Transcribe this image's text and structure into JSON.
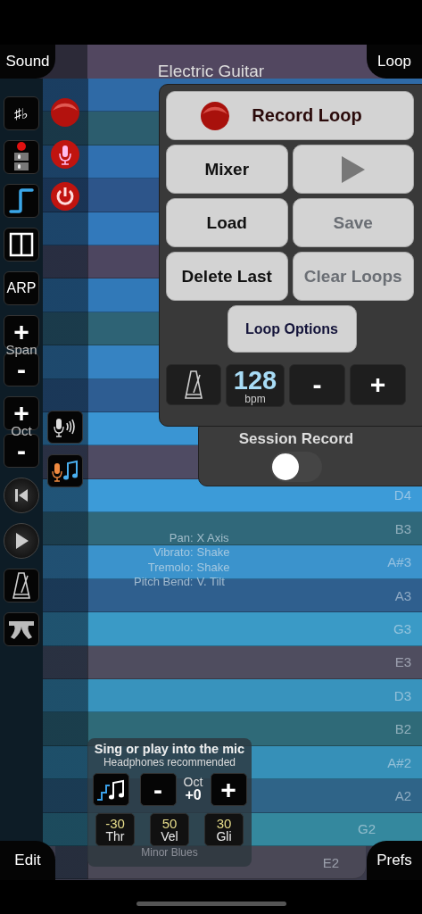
{
  "top_left_tab": {
    "label": "Sound"
  },
  "top_right_tab": {
    "label": "Loop"
  },
  "instrument_title": "Electric Guitar",
  "rows": [
    {
      "color": "#2f6aa6"
    },
    {
      "color": "#2c5d6e"
    },
    {
      "color": "#3070b0"
    },
    {
      "color": "#2d558a"
    },
    {
      "color": "#3279bb"
    },
    {
      "color": "#4d4660"
    },
    {
      "color": "#3179b8"
    },
    {
      "color": "#2e6375"
    },
    {
      "color": "#3683c2"
    },
    {
      "color": "#2e5d92"
    },
    {
      "color": "#3a95d3"
    },
    {
      "color": "#4f4b63"
    },
    {
      "color": "#3c9bd8",
      "note": "D4"
    },
    {
      "color": "#30687a",
      "note": "B3"
    },
    {
      "color": "#3b93cc",
      "note": "A#3"
    },
    {
      "color": "#2f5f8e",
      "note": "A3"
    },
    {
      "color": "#3a9ac6",
      "note": "G3"
    },
    {
      "color": "#4f4d5f",
      "note": "E3"
    },
    {
      "color": "#3893bd",
      "note": "D3"
    },
    {
      "color": "#2f6a78",
      "note": "B2"
    },
    {
      "color": "#3690b8",
      "note": "A#2"
    },
    {
      "color": "#2f6488",
      "note": "A2"
    },
    {
      "color": "#34889e",
      "note": "G2"
    },
    {
      "color": "#4a4856",
      "note": "E2"
    }
  ],
  "sidebar": [
    {
      "kind": "text",
      "label": "♯♭"
    },
    {
      "kind": "mode-stack"
    },
    {
      "kind": "step"
    },
    {
      "kind": "split"
    },
    {
      "kind": "text",
      "label": "ARP"
    },
    {
      "kind": "stepper",
      "label": "Span",
      "plus": "+",
      "minus": "-"
    },
    {
      "kind": "stepper",
      "label": "Oct",
      "plus": "+",
      "minus": "-"
    },
    {
      "kind": "rewind"
    },
    {
      "kind": "play"
    },
    {
      "kind": "metronome"
    },
    {
      "kind": "pedal"
    }
  ],
  "red_buttons": [
    {
      "kind": "record"
    },
    {
      "kind": "mic"
    },
    {
      "kind": "power"
    }
  ],
  "pitch_buttons": [
    {
      "kind": "mic-sound"
    },
    {
      "kind": "mic-note"
    }
  ],
  "loop_panel": {
    "record_button": "Record Loop",
    "buttons": [
      {
        "kind": "text",
        "label": "Mixer",
        "disabled": false
      },
      {
        "kind": "play",
        "disabled": false
      },
      {
        "kind": "text",
        "label": "Load",
        "disabled": false
      },
      {
        "kind": "text",
        "label": "Save",
        "disabled": true
      },
      {
        "kind": "text",
        "label": "Delete Last",
        "disabled": false
      },
      {
        "kind": "text",
        "label": "Clear Loops",
        "disabled": true
      }
    ],
    "options_button": "Loop Options",
    "tempo": {
      "value": "128",
      "unit": "bpm"
    },
    "tempo_minus": "-",
    "tempo_plus": "+"
  },
  "session_record": {
    "label": "Session Record",
    "on": false
  },
  "gesture_hints": [
    {
      "label": "Pan:",
      "value": "X Axis"
    },
    {
      "label": "Vibrato:",
      "value": "Shake"
    },
    {
      "label": "Tremolo:",
      "value": "Shake"
    },
    {
      "label": "Pitch Bend:",
      "value": "V. Tilt"
    }
  ],
  "mic_panel": {
    "title": "Sing or play into the mic",
    "subtitle": "Headphones recommended",
    "minus": "-",
    "octave_label": "Oct",
    "octave_value": "+0",
    "plus": "+",
    "params": [
      {
        "value": "-30",
        "label": "Thr"
      },
      {
        "value": "50",
        "label": "Vel"
      },
      {
        "value": "30",
        "label": "Gli"
      }
    ],
    "scale_name": "Minor Blues"
  },
  "bottom_left_tab": {
    "label": "Edit"
  },
  "bottom_right_tab": {
    "label": "Prefs"
  }
}
